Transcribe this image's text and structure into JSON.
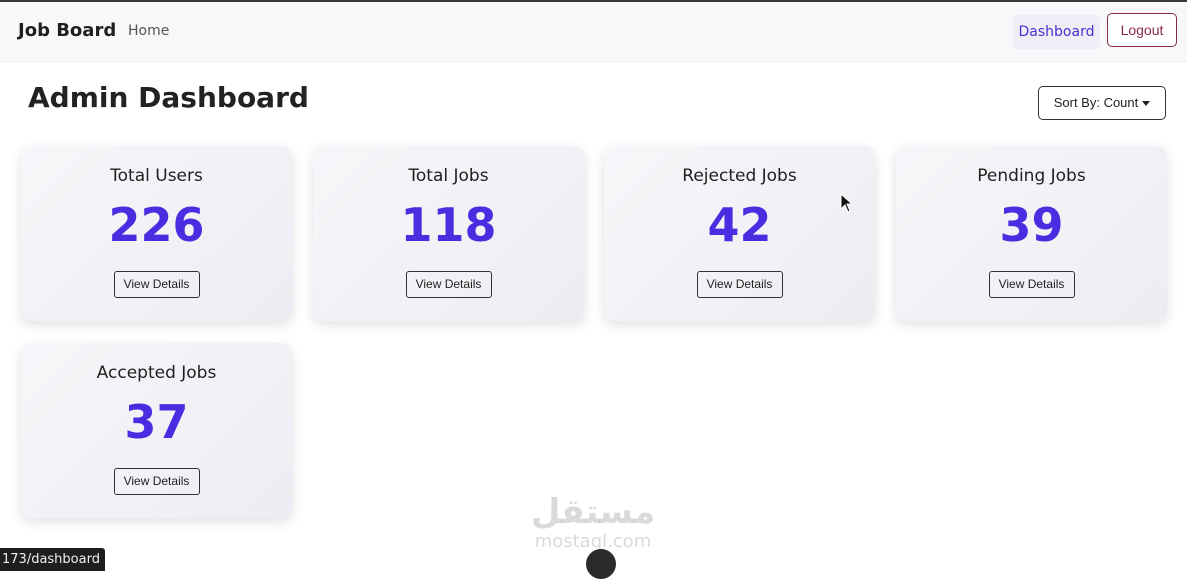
{
  "navbar": {
    "brand": "Job Board",
    "home": "Home",
    "dashboard": "Dashboard",
    "logout": "Logout"
  },
  "header": {
    "title": "Admin Dashboard",
    "sort_label": "Sort By: Count"
  },
  "cards": [
    {
      "title": "Total Users",
      "value": "226",
      "button": "View Details"
    },
    {
      "title": "Total Jobs",
      "value": "118",
      "button": "View Details"
    },
    {
      "title": "Rejected Jobs",
      "value": "42",
      "button": "View Details"
    },
    {
      "title": "Pending Jobs",
      "value": "39",
      "button": "View Details"
    },
    {
      "title": "Accepted Jobs",
      "value": "37",
      "button": "View Details"
    }
  ],
  "watermark": {
    "arabic": "مستقل",
    "latin": "mostaql.com"
  },
  "status_bar": {
    "url": "173/dashboard"
  },
  "colors": {
    "accent": "#4a2de0",
    "logout": "#8a2a4a"
  }
}
